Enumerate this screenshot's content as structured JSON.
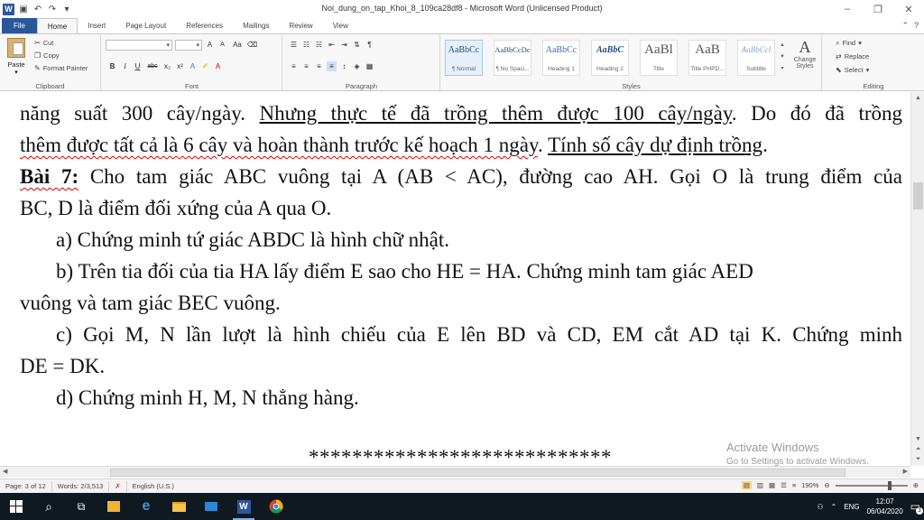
{
  "window": {
    "title": "Noi_dung_on_tap_Khoi_8_109ca28df8  -  Microsoft Word (Unlicensed Product)",
    "logo_letter": "W",
    "controls": [
      "–",
      "❐",
      "✕"
    ]
  },
  "tabs": [
    {
      "label": "File"
    },
    {
      "label": "Home"
    },
    {
      "label": "Insert"
    },
    {
      "label": "Page Layout"
    },
    {
      "label": "References"
    },
    {
      "label": "Mailings"
    },
    {
      "label": "Review"
    },
    {
      "label": "View"
    }
  ],
  "ribbon": {
    "clipboard": {
      "label": "Clipboard",
      "paste": "Paste",
      "cut": "Cut",
      "copy": "Copy",
      "format_painter": "Format Painter"
    },
    "font": {
      "label": "Font",
      "bold": "B",
      "italic": "I",
      "underline": "U",
      "strike": "abc",
      "sub": "x₂",
      "sup": "x²",
      "grow": "A",
      "shrink": "A",
      "case": "Aa"
    },
    "paragraph": {
      "label": "Paragraph"
    },
    "styles": {
      "label": "Styles",
      "items": [
        {
          "sample": "AaBbCc",
          "name": "¶ Normal"
        },
        {
          "sample": "AaBbCcDc",
          "name": "¶ No Spaci..."
        },
        {
          "sample": "AaBbCc",
          "name": "Heading 1"
        },
        {
          "sample": "AaBbC",
          "name": "Heading 2"
        },
        {
          "sample": "AaBl",
          "name": "Title"
        },
        {
          "sample": "AaB",
          "name": "Title PHPD..."
        },
        {
          "sample": "AaBbCcl",
          "name": "Subtitle"
        }
      ],
      "change_styles": "Change Styles"
    },
    "editing": {
      "label": "Editing",
      "find": "Find",
      "replace": "Replace",
      "select": "Select"
    }
  },
  "document": {
    "line1": [
      "năng suất 300 cây/ngày. ",
      "Nhưng thực tế đã trồng thêm được 100 cây/ngày",
      ". Do đó đã trồng"
    ],
    "line2": [
      "thêm được tất cả là 6 cây và hoàn thành trước kế hoạch 1 ngày",
      ". ",
      "Tính số cây dự định trồng",
      "."
    ],
    "bai7_label": "Bài 7:",
    "bai7_text": " Cho tam giác ABC vuông tại A (AB < AC), đường cao AH. Gọi O là trung điểm của",
    "line4": "BC, D là điểm đối xứng của A qua O.",
    "line5": "a) Chứng minh tứ giác ABDC là hình chữ nhật.",
    "line6": "b) Trên tia đối của tia HA lấy điểm E sao cho HE = HA. Chứng minh tam giác AED",
    "line7": "vuông và tam giác BEC vuông.",
    "line8": "c) Gọi M, N lần lượt là hình chiếu của E lên BD và CD, EM cắt AD tại K. Chứng minh",
    "line9": "DE = DK.",
    "line10": "d) Chứng minh H, M, N thẳng hàng.",
    "stars": "****************************"
  },
  "watermark": {
    "line1": "Activate Windows",
    "line2": "Go to Settings to activate Windows."
  },
  "status": {
    "page": "Page: 3 of 12",
    "words": "Words: 2/3,513",
    "language": "English (U.S.)",
    "zoom": "190%"
  },
  "taskbar": {
    "time": "12:07",
    "date": "06/04/2020",
    "lang": "ENG",
    "notif_count": "3"
  }
}
